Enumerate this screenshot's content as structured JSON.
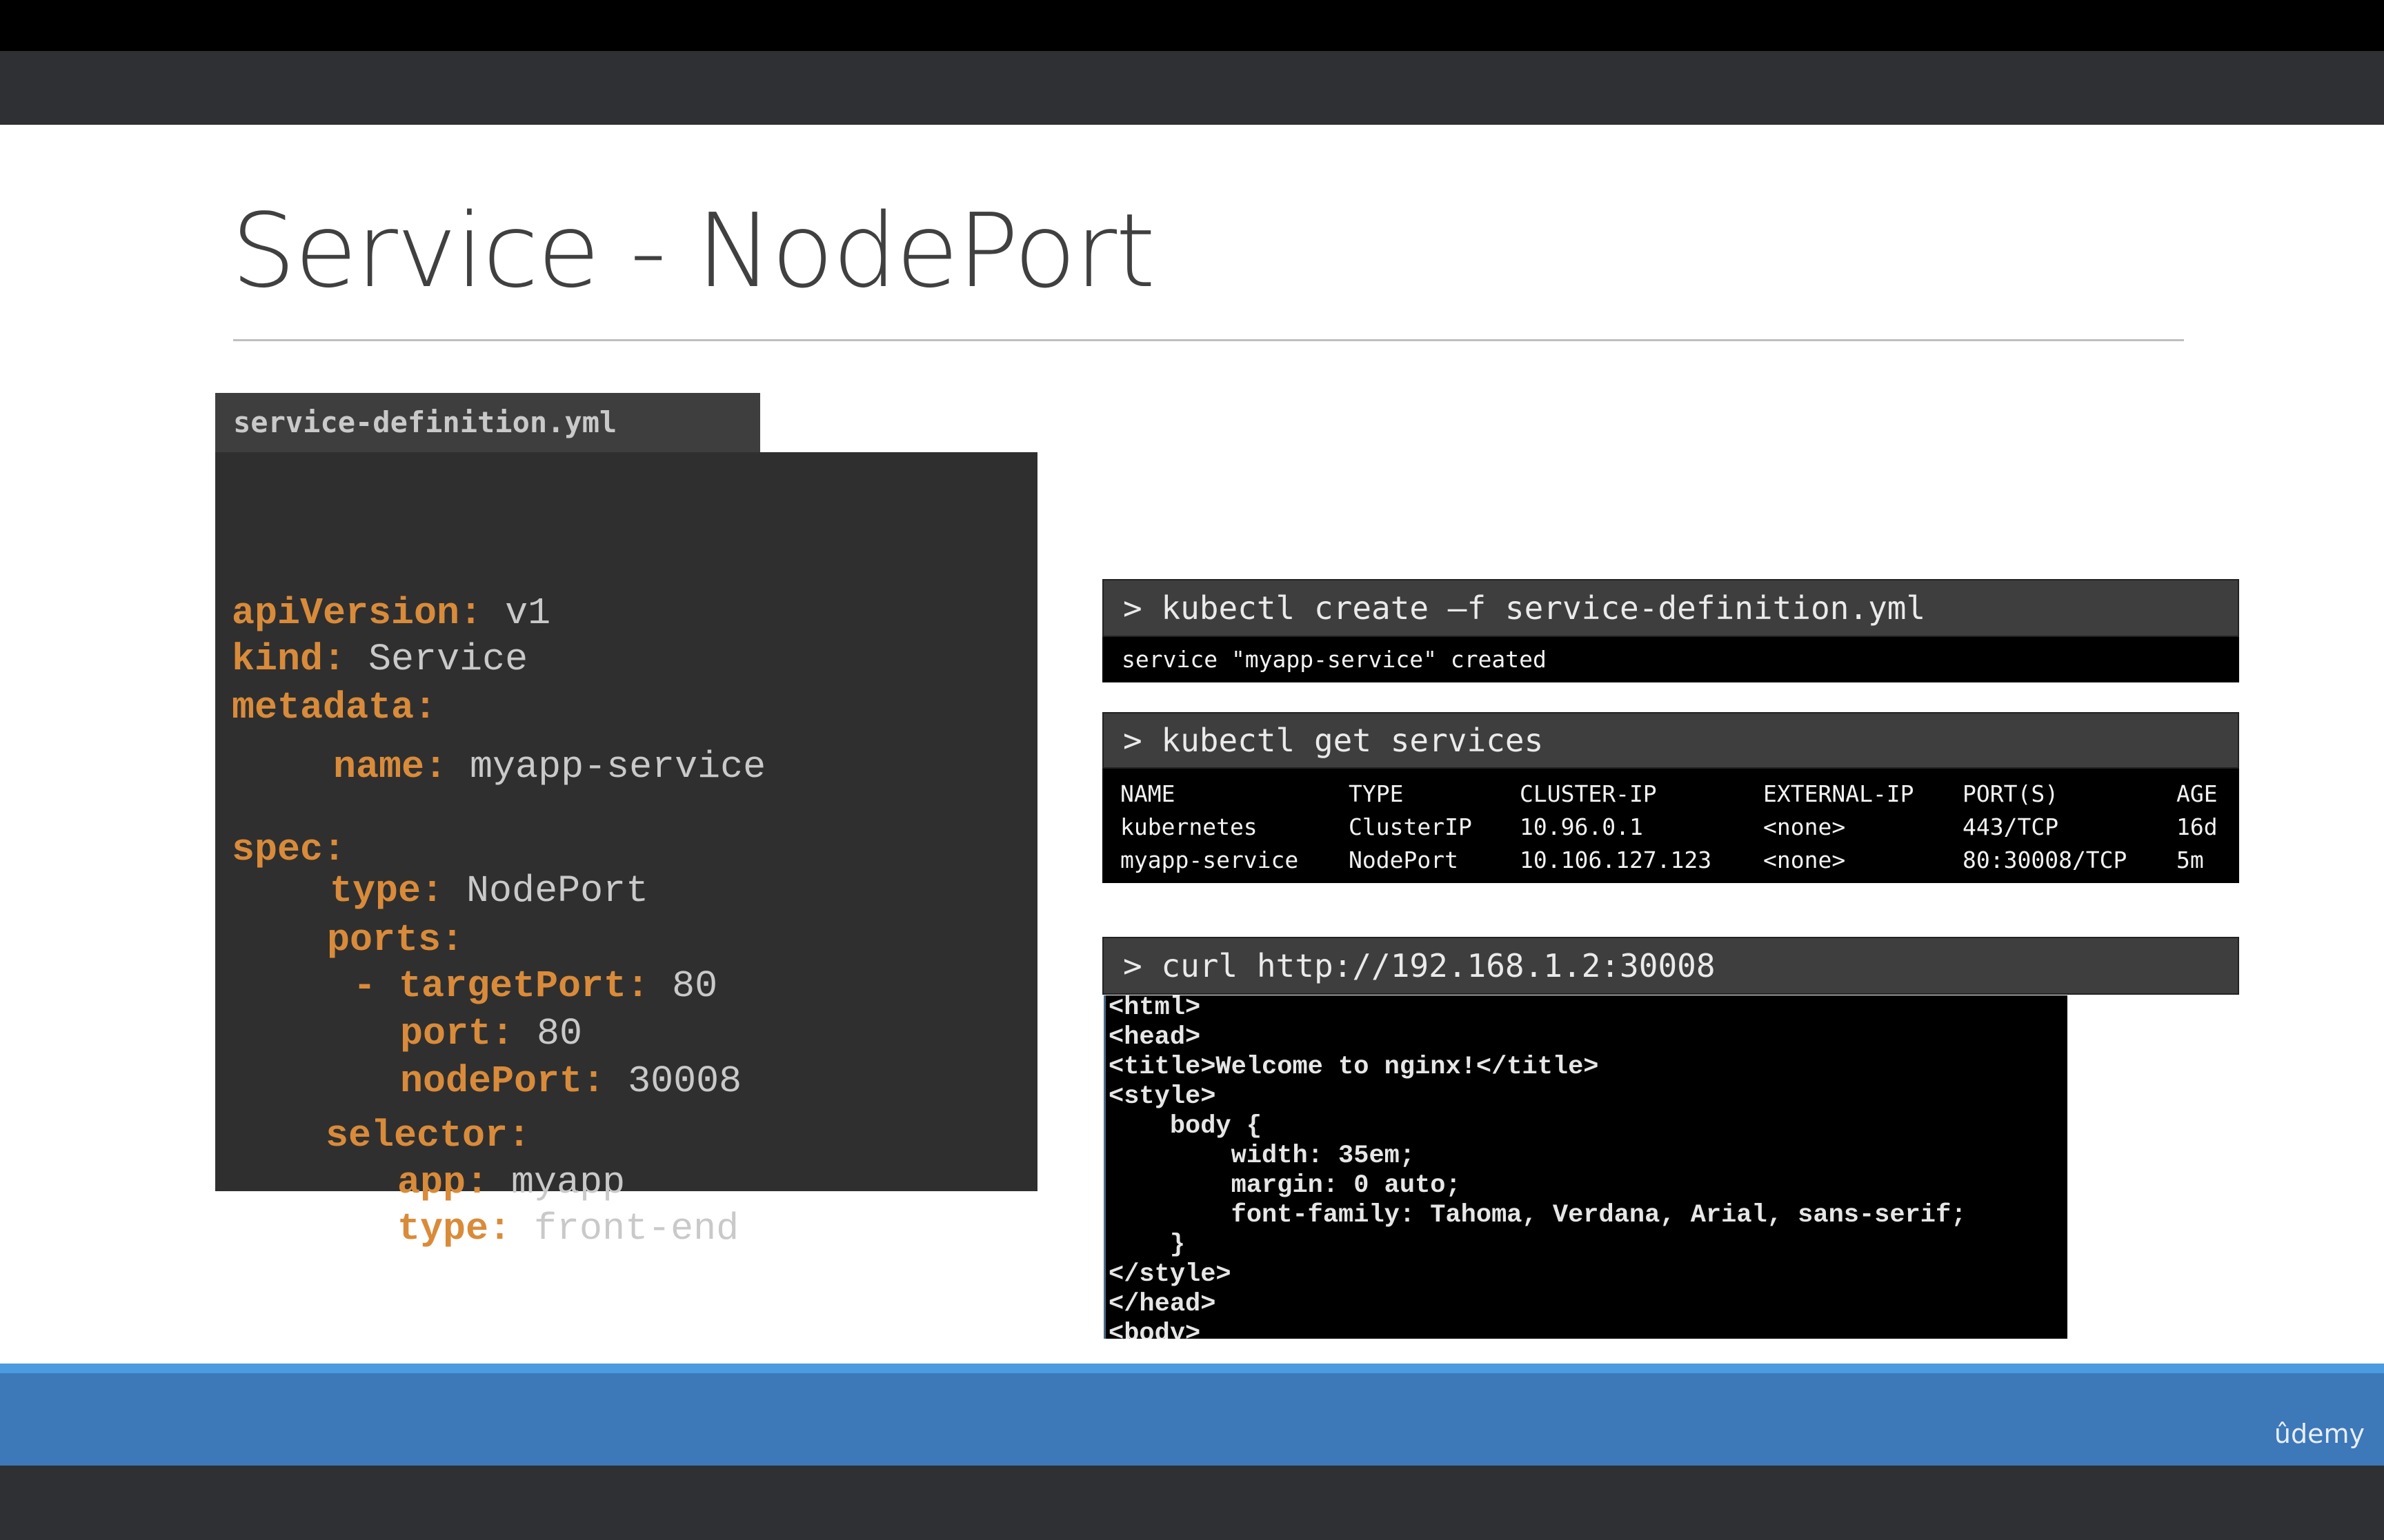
{
  "slide": {
    "title": "Service - NodePort"
  },
  "yaml": {
    "filename": "service-definition.yml",
    "lines": [
      {
        "key": "apiVersion:",
        "value": "v1"
      },
      {
        "key": "kind:",
        "value": "Service"
      },
      {
        "key": "metadata:",
        "value": ""
      },
      {
        "key": "name:",
        "value": "myapp-service"
      },
      {
        "key": "spec:",
        "value": ""
      },
      {
        "key": "type:",
        "value": "NodePort"
      },
      {
        "key": "ports:",
        "value": ""
      },
      {
        "key": "- targetPort:",
        "value": "80"
      },
      {
        "key": "port:",
        "value": "80"
      },
      {
        "key": "nodePort:",
        "value": "30008"
      },
      {
        "key": "selector:",
        "value": ""
      },
      {
        "key": "app:",
        "value": "myapp"
      },
      {
        "key": "type:",
        "value": "front-end"
      }
    ]
  },
  "terminal1": {
    "command": "> kubectl create –f service-definition.yml",
    "output": "service \"myapp-service\" created"
  },
  "terminal2": {
    "command": "> kubectl get services",
    "headers": [
      "NAME",
      "TYPE",
      "CLUSTER-IP",
      "EXTERNAL-IP",
      "PORT(S)",
      "AGE"
    ],
    "rows": [
      [
        "kubernetes",
        "ClusterIP",
        "10.96.0.1",
        "<none>",
        "443/TCP",
        "16d"
      ],
      [
        "myapp-service",
        "NodePort",
        "10.106.127.123",
        "<none>",
        "80:30008/TCP",
        "5m"
      ]
    ]
  },
  "terminal3": {
    "command": "> curl http://192.168.1.2:30008",
    "output_lines": [
      "<html>",
      "<head>",
      "<title>Welcome to nginx!</title>",
      "<style>",
      "    body {",
      "        width: 35em;",
      "        margin: 0 auto;",
      "        font-family: Tahoma, Verdana, Arial, sans-serif;",
      "    }",
      "</style>",
      "</head>",
      "<body>"
    ]
  },
  "branding": {
    "logo_text": "ûdemy"
  }
}
